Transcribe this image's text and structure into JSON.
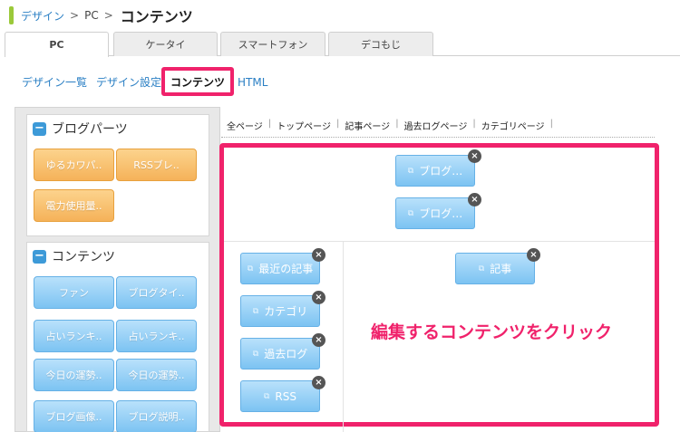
{
  "breadcrumb": {
    "link1": "デザイン",
    "sep1": ">",
    "item2": "PC",
    "sep2": ">",
    "current": "コンテンツ"
  },
  "tabs": [
    "PC",
    "ケータイ",
    "スマートフォン",
    "デコもじ"
  ],
  "subnav": {
    "items": [
      "デザイン一覧",
      "デザイン設定",
      "コンテンツ",
      "HTML"
    ]
  },
  "sidebar": {
    "blog_parts": {
      "title": "ブログパーツ",
      "buttons": [
        "ゆるカワパ..",
        "RSSブレ..",
        "電力使用量.."
      ]
    },
    "contents": {
      "title": "コンテンツ",
      "buttons": [
        "ファン",
        "ブログタイ..",
        "占いランキ..",
        "占いランキ..",
        "今日の運勢..",
        "今日の運勢..",
        "ブログ画像..",
        "ブログ説明.."
      ]
    }
  },
  "page_links": [
    "全ページ",
    "トップページ",
    "記事ページ",
    "過去ログページ",
    "カテゴリページ"
  ],
  "canvas": {
    "top_widgets": [
      "ブログ…",
      "ブログ…"
    ],
    "left_widgets": [
      "最近の記事",
      "カテゴリ",
      "過去ログ",
      "RSS"
    ],
    "main_widget": "記事",
    "close_symbol": "×"
  },
  "hint_text": "編集するコンテンツをクリック",
  "colors": {
    "highlight": "#f0226b",
    "link": "#2a7fc4",
    "widget_blue": "#7cc3f2",
    "part_orange": "#f5b259",
    "breadcrumb_bar": "#9bc93a"
  }
}
